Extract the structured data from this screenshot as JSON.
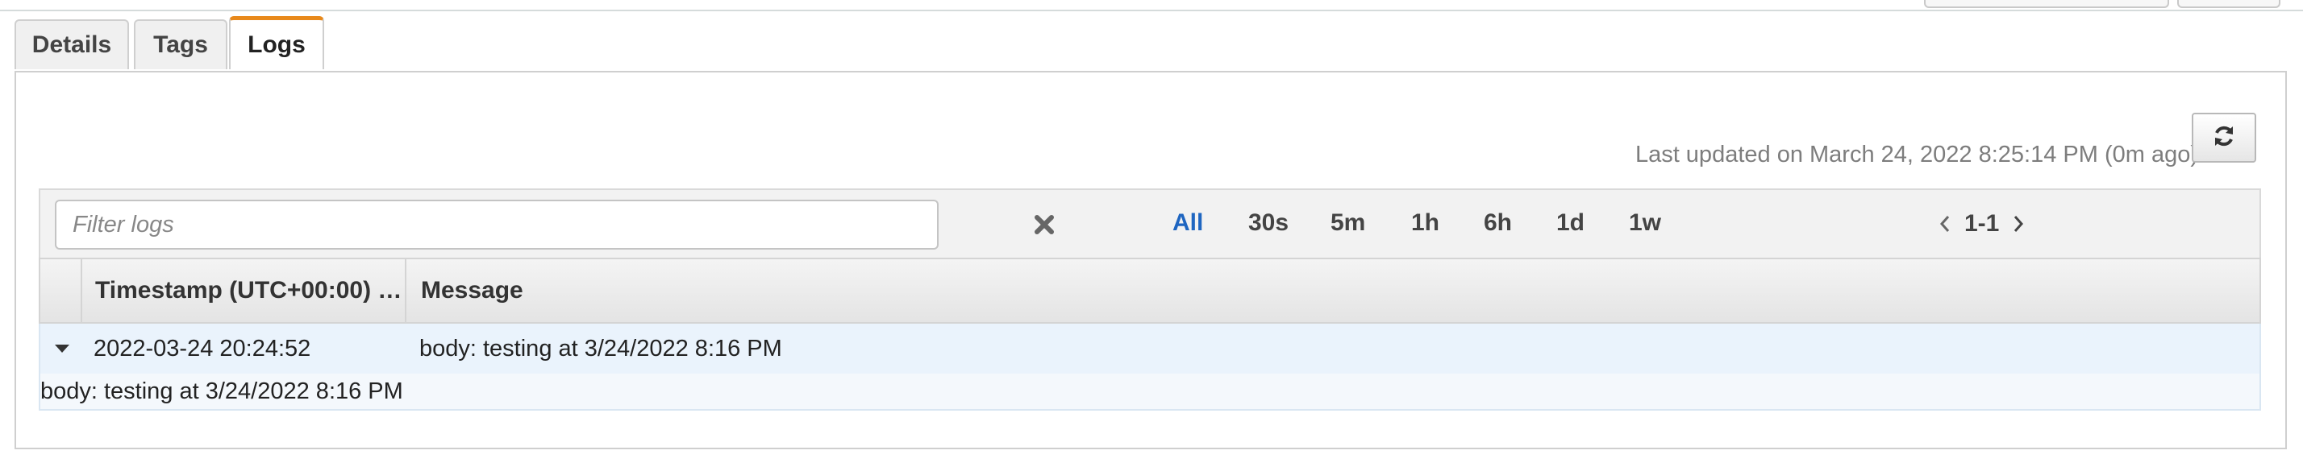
{
  "tabs": [
    {
      "label": "Details",
      "active": false
    },
    {
      "label": "Tags",
      "active": false
    },
    {
      "label": "Logs",
      "active": true
    }
  ],
  "logs": {
    "last_updated": "Last updated on March 24, 2022 8:25:14 PM (0m ago)",
    "refresh_icon": "refresh-icon",
    "filter": {
      "placeholder": "Filter logs",
      "value": ""
    },
    "clear_icon": "clear-x-icon",
    "time_ranges": [
      "All",
      "30s",
      "5m",
      "1h",
      "6h",
      "1d",
      "1w"
    ],
    "active_range": "All",
    "pagination": {
      "label": "1-1"
    },
    "columns": [
      "Timestamp (UTC+00:00) …",
      "Message"
    ],
    "rows": [
      {
        "timestamp": "2022-03-24 20:24:52",
        "message": "body: testing at 3/24/2022 8:16 PM",
        "expanded": true,
        "detail": "body: testing at 3/24/2022 8:16 PM"
      }
    ]
  },
  "colors": {
    "accent_tab": "#e8891b",
    "active_range": "#1f66c1",
    "row_highlight": "#eaf3fc"
  }
}
